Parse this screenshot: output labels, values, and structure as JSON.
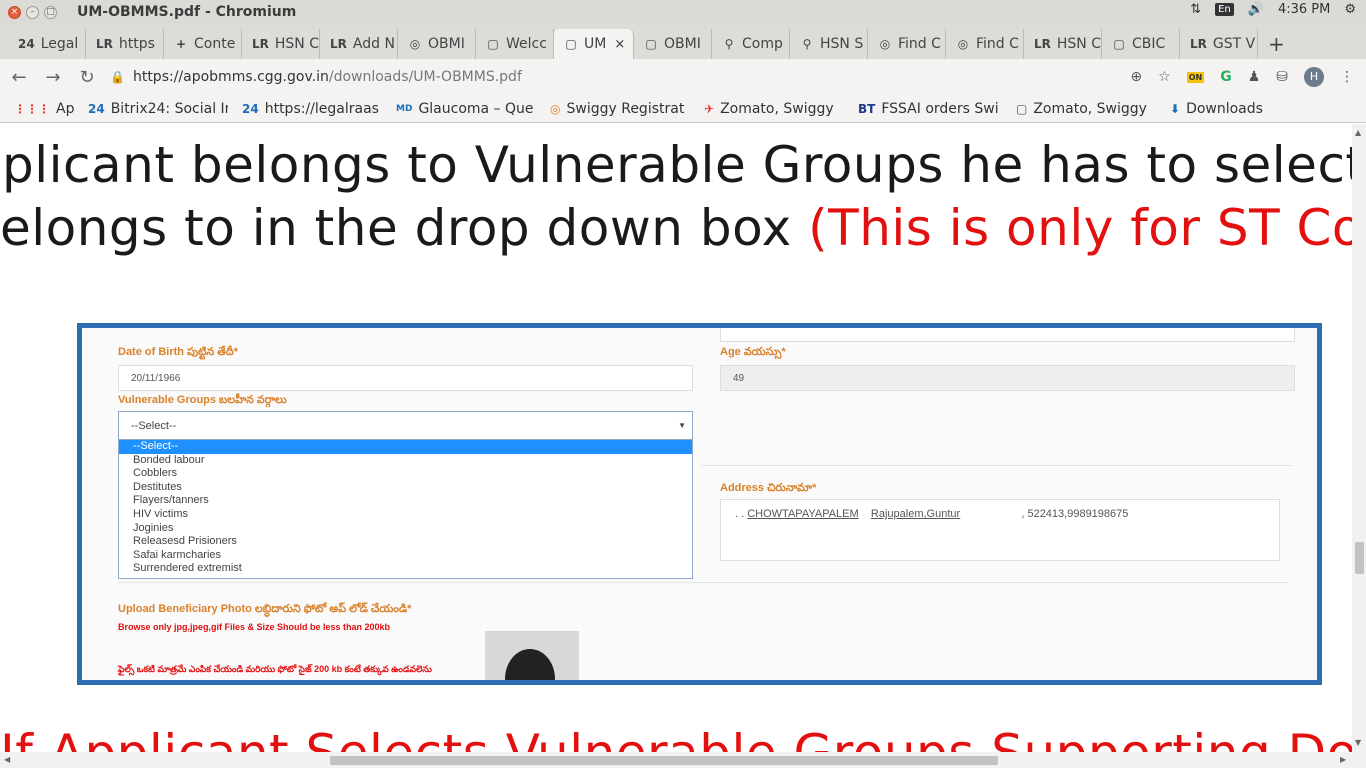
{
  "os": {
    "window_title": "UM-OBMMS.pdf - Chromium",
    "lang": "En",
    "time": "4:36 PM"
  },
  "tabs": [
    {
      "icon": "24",
      "label": "Legal"
    },
    {
      "icon": "LR",
      "label": "https"
    },
    {
      "icon": "+",
      "label": "Conte"
    },
    {
      "icon": "LR",
      "label": "HSN C"
    },
    {
      "icon": "LR",
      "label": "Add N"
    },
    {
      "icon": "◎",
      "label": "OBMI"
    },
    {
      "icon": "▢",
      "label": "Welcc"
    },
    {
      "icon": "▢",
      "label": "UM",
      "active": true
    },
    {
      "icon": "▢",
      "label": "OBMI"
    },
    {
      "icon": "⚲",
      "label": "Comp"
    },
    {
      "icon": "⚲",
      "label": "HSN S"
    },
    {
      "icon": "◎",
      "label": "Find C"
    },
    {
      "icon": "◎",
      "label": "Find C"
    },
    {
      "icon": "LR",
      "label": "HSN C"
    },
    {
      "icon": "▢",
      "label": "CBIC"
    },
    {
      "icon": "LR",
      "label": "GST V"
    }
  ],
  "address_bar": {
    "host": "https://apobmms.cgg.gov.in",
    "path": "/downloads/UM-OBMMS.pdf"
  },
  "bookmarks": [
    {
      "icon": "⋮⋮⋮",
      "label": "Apps"
    },
    {
      "icon": "24",
      "label": "Bitrix24: Social Ir"
    },
    {
      "icon": "24",
      "label": "https://legalraas"
    },
    {
      "icon": "MD",
      "label": "Glaucoma – Que"
    },
    {
      "icon": "◎",
      "label": "Swiggy Registrat"
    },
    {
      "icon": "✈",
      "label": "Zomato, Swiggy"
    },
    {
      "icon": "BT",
      "label": "FSSAI orders Swi"
    },
    {
      "icon": "▢",
      "label": "Zomato, Swiggy"
    },
    {
      "icon": "⬇",
      "label": "Downloads"
    }
  ],
  "doc": {
    "line1": "plicant belongs to Vulnerable Groups he has to select w",
    "line2_black": "elongs to in the drop down box ",
    "line2_red": "(This is only for ST Corpor",
    "line3_red": "If Applicant Selects Vulnerable Groups Supporting Doc"
  },
  "form": {
    "dob_label": "Date of Birth పుట్టిన తేదీ*",
    "dob_value": "20/11/1966",
    "age_label": "Age వయస్సు*",
    "age_value": "49",
    "vg_label": "Vulnerable Groups బలహీన వర్గాలు",
    "vg_selected": "--Select--",
    "vg_options": [
      "--Select--",
      "Bonded labour",
      "Cobblers",
      "Destitutes",
      "Flayers/tanners",
      "HIV victims",
      "Joginies",
      "Releasesd Prisioners",
      "Safai karmcharies",
      "Surrendered extremist"
    ],
    "address_label": "Address చిరునామా*",
    "address_village": "CHOWTAPAYAPALEM",
    "address_mandal": "Rajupalem,Guntur",
    "address_rest": "522413,9989198675",
    "photo_label": "Upload Beneficiary Photo లబ్ధిదారుని ఫోటో అప్ లోడ్ చేయండి*",
    "photo_hint": "Browse only jpg,jpeg,gif Files & Size Should be less than 200kb",
    "photo_hint_te": "ఫైల్స్ ఒకటి మాత్రమే ఎంపిక చేయండి మరియు ఫోటో సైజ్ 200 kb కంటే తక్కువ ఉండవలెను"
  }
}
